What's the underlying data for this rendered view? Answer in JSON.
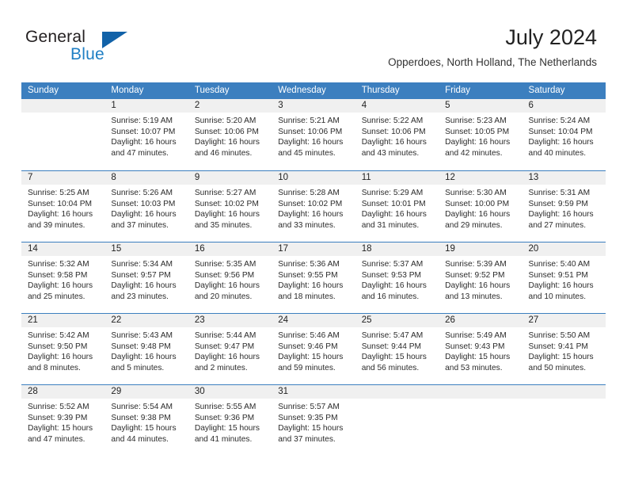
{
  "brand": {
    "name_part1": "General",
    "name_part2": "Blue",
    "triangle_color": "#1262a8",
    "blue_color": "#1f7fc4"
  },
  "header": {
    "title": "July 2024",
    "subtitle": "Opperdoes, North Holland, The Netherlands"
  },
  "theme": {
    "header_blue": "#3c7fbf",
    "daynum_gray": "#f0f0f0",
    "text": "#2b2b2b"
  },
  "weekdays": [
    "Sunday",
    "Monday",
    "Tuesday",
    "Wednesday",
    "Thursday",
    "Friday",
    "Saturday"
  ],
  "weeks": [
    [
      {
        "day": "",
        "empty": true,
        "sunrise": "",
        "sunset": "",
        "daylight1": "",
        "daylight2": ""
      },
      {
        "day": "1",
        "sunrise": "Sunrise: 5:19 AM",
        "sunset": "Sunset: 10:07 PM",
        "daylight1": "Daylight: 16 hours",
        "daylight2": "and 47 minutes."
      },
      {
        "day": "2",
        "sunrise": "Sunrise: 5:20 AM",
        "sunset": "Sunset: 10:06 PM",
        "daylight1": "Daylight: 16 hours",
        "daylight2": "and 46 minutes."
      },
      {
        "day": "3",
        "sunrise": "Sunrise: 5:21 AM",
        "sunset": "Sunset: 10:06 PM",
        "daylight1": "Daylight: 16 hours",
        "daylight2": "and 45 minutes."
      },
      {
        "day": "4",
        "sunrise": "Sunrise: 5:22 AM",
        "sunset": "Sunset: 10:06 PM",
        "daylight1": "Daylight: 16 hours",
        "daylight2": "and 43 minutes."
      },
      {
        "day": "5",
        "sunrise": "Sunrise: 5:23 AM",
        "sunset": "Sunset: 10:05 PM",
        "daylight1": "Daylight: 16 hours",
        "daylight2": "and 42 minutes."
      },
      {
        "day": "6",
        "sunrise": "Sunrise: 5:24 AM",
        "sunset": "Sunset: 10:04 PM",
        "daylight1": "Daylight: 16 hours",
        "daylight2": "and 40 minutes."
      }
    ],
    [
      {
        "day": "7",
        "sunrise": "Sunrise: 5:25 AM",
        "sunset": "Sunset: 10:04 PM",
        "daylight1": "Daylight: 16 hours",
        "daylight2": "and 39 minutes."
      },
      {
        "day": "8",
        "sunrise": "Sunrise: 5:26 AM",
        "sunset": "Sunset: 10:03 PM",
        "daylight1": "Daylight: 16 hours",
        "daylight2": "and 37 minutes."
      },
      {
        "day": "9",
        "sunrise": "Sunrise: 5:27 AM",
        "sunset": "Sunset: 10:02 PM",
        "daylight1": "Daylight: 16 hours",
        "daylight2": "and 35 minutes."
      },
      {
        "day": "10",
        "sunrise": "Sunrise: 5:28 AM",
        "sunset": "Sunset: 10:02 PM",
        "daylight1": "Daylight: 16 hours",
        "daylight2": "and 33 minutes."
      },
      {
        "day": "11",
        "sunrise": "Sunrise: 5:29 AM",
        "sunset": "Sunset: 10:01 PM",
        "daylight1": "Daylight: 16 hours",
        "daylight2": "and 31 minutes."
      },
      {
        "day": "12",
        "sunrise": "Sunrise: 5:30 AM",
        "sunset": "Sunset: 10:00 PM",
        "daylight1": "Daylight: 16 hours",
        "daylight2": "and 29 minutes."
      },
      {
        "day": "13",
        "sunrise": "Sunrise: 5:31 AM",
        "sunset": "Sunset: 9:59 PM",
        "daylight1": "Daylight: 16 hours",
        "daylight2": "and 27 minutes."
      }
    ],
    [
      {
        "day": "14",
        "sunrise": "Sunrise: 5:32 AM",
        "sunset": "Sunset: 9:58 PM",
        "daylight1": "Daylight: 16 hours",
        "daylight2": "and 25 minutes."
      },
      {
        "day": "15",
        "sunrise": "Sunrise: 5:34 AM",
        "sunset": "Sunset: 9:57 PM",
        "daylight1": "Daylight: 16 hours",
        "daylight2": "and 23 minutes."
      },
      {
        "day": "16",
        "sunrise": "Sunrise: 5:35 AM",
        "sunset": "Sunset: 9:56 PM",
        "daylight1": "Daylight: 16 hours",
        "daylight2": "and 20 minutes."
      },
      {
        "day": "17",
        "sunrise": "Sunrise: 5:36 AM",
        "sunset": "Sunset: 9:55 PM",
        "daylight1": "Daylight: 16 hours",
        "daylight2": "and 18 minutes."
      },
      {
        "day": "18",
        "sunrise": "Sunrise: 5:37 AM",
        "sunset": "Sunset: 9:53 PM",
        "daylight1": "Daylight: 16 hours",
        "daylight2": "and 16 minutes."
      },
      {
        "day": "19",
        "sunrise": "Sunrise: 5:39 AM",
        "sunset": "Sunset: 9:52 PM",
        "daylight1": "Daylight: 16 hours",
        "daylight2": "and 13 minutes."
      },
      {
        "day": "20",
        "sunrise": "Sunrise: 5:40 AM",
        "sunset": "Sunset: 9:51 PM",
        "daylight1": "Daylight: 16 hours",
        "daylight2": "and 10 minutes."
      }
    ],
    [
      {
        "day": "21",
        "sunrise": "Sunrise: 5:42 AM",
        "sunset": "Sunset: 9:50 PM",
        "daylight1": "Daylight: 16 hours",
        "daylight2": "and 8 minutes."
      },
      {
        "day": "22",
        "sunrise": "Sunrise: 5:43 AM",
        "sunset": "Sunset: 9:48 PM",
        "daylight1": "Daylight: 16 hours",
        "daylight2": "and 5 minutes."
      },
      {
        "day": "23",
        "sunrise": "Sunrise: 5:44 AM",
        "sunset": "Sunset: 9:47 PM",
        "daylight1": "Daylight: 16 hours",
        "daylight2": "and 2 minutes."
      },
      {
        "day": "24",
        "sunrise": "Sunrise: 5:46 AM",
        "sunset": "Sunset: 9:46 PM",
        "daylight1": "Daylight: 15 hours",
        "daylight2": "and 59 minutes."
      },
      {
        "day": "25",
        "sunrise": "Sunrise: 5:47 AM",
        "sunset": "Sunset: 9:44 PM",
        "daylight1": "Daylight: 15 hours",
        "daylight2": "and 56 minutes."
      },
      {
        "day": "26",
        "sunrise": "Sunrise: 5:49 AM",
        "sunset": "Sunset: 9:43 PM",
        "daylight1": "Daylight: 15 hours",
        "daylight2": "and 53 minutes."
      },
      {
        "day": "27",
        "sunrise": "Sunrise: 5:50 AM",
        "sunset": "Sunset: 9:41 PM",
        "daylight1": "Daylight: 15 hours",
        "daylight2": "and 50 minutes."
      }
    ],
    [
      {
        "day": "28",
        "sunrise": "Sunrise: 5:52 AM",
        "sunset": "Sunset: 9:39 PM",
        "daylight1": "Daylight: 15 hours",
        "daylight2": "and 47 minutes."
      },
      {
        "day": "29",
        "sunrise": "Sunrise: 5:54 AM",
        "sunset": "Sunset: 9:38 PM",
        "daylight1": "Daylight: 15 hours",
        "daylight2": "and 44 minutes."
      },
      {
        "day": "30",
        "sunrise": "Sunrise: 5:55 AM",
        "sunset": "Sunset: 9:36 PM",
        "daylight1": "Daylight: 15 hours",
        "daylight2": "and 41 minutes."
      },
      {
        "day": "31",
        "sunrise": "Sunrise: 5:57 AM",
        "sunset": "Sunset: 9:35 PM",
        "daylight1": "Daylight: 15 hours",
        "daylight2": "and 37 minutes."
      },
      {
        "day": "",
        "empty": true,
        "sunrise": "",
        "sunset": "",
        "daylight1": "",
        "daylight2": ""
      },
      {
        "day": "",
        "empty": true,
        "sunrise": "",
        "sunset": "",
        "daylight1": "",
        "daylight2": ""
      },
      {
        "day": "",
        "empty": true,
        "sunrise": "",
        "sunset": "",
        "daylight1": "",
        "daylight2": ""
      }
    ]
  ]
}
